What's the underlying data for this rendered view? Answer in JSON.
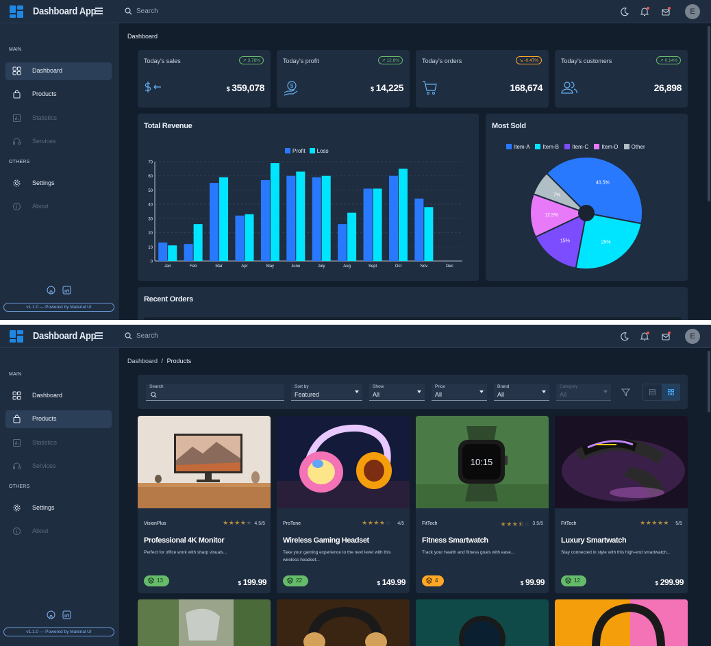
{
  "app": {
    "title": "Dashboard App",
    "avatar_letter": "E",
    "search_placeholder": "Search"
  },
  "sidebar": {
    "main_title": "MAIN",
    "others_title": "OTHERS",
    "items": [
      {
        "label": "Dashboard",
        "icon": "grid-icon"
      },
      {
        "label": "Products",
        "icon": "shopping-bag-icon"
      },
      {
        "label": "Statistics",
        "icon": "bar-chart-icon"
      },
      {
        "label": "Services",
        "icon": "headset-icon"
      },
      {
        "label": "Settings",
        "icon": "gear-icon"
      },
      {
        "label": "About",
        "icon": "info-icon"
      }
    ],
    "version": "v1.1.0 — Powered by Material UI"
  },
  "dashboard": {
    "breadcrumb": "Dashboard",
    "stats": [
      {
        "title": "Today's sales",
        "badge": "3.78%",
        "trend": "up",
        "currency": "$",
        "value": "359,078",
        "icon": "dollar-arrow-icon"
      },
      {
        "title": "Today's profit",
        "badge": "12.6%",
        "trend": "up",
        "currency": "$",
        "value": "14,225",
        "icon": "hand-coin-icon"
      },
      {
        "title": "Today's orders",
        "badge": "-0.47%",
        "trend": "down",
        "currency": "",
        "value": "168,674",
        "icon": "cart-icon"
      },
      {
        "title": "Today's customers",
        "badge": "0.14%",
        "trend": "up",
        "currency": "",
        "value": "26,898",
        "icon": "users-icon"
      }
    ],
    "revenue_title": "Total Revenue",
    "most_sold_title": "Most Sold",
    "recent_orders_title": "Recent Orders"
  },
  "chart_data": [
    {
      "type": "bar",
      "title": "Total Revenue",
      "categories": [
        "Jan",
        "Feb",
        "Mar",
        "Apr",
        "May",
        "June",
        "July",
        "Aug",
        "Sept",
        "Oct",
        "Nov",
        "Dec"
      ],
      "series": [
        {
          "name": "Profit",
          "color": "#2979ff",
          "values": [
            13,
            12,
            55,
            32,
            57,
            60,
            59,
            26,
            51,
            60,
            44,
            0
          ]
        },
        {
          "name": "Loss",
          "color": "#00e5ff",
          "values": [
            11,
            26,
            59,
            33,
            69,
            63,
            60,
            34,
            51,
            65,
            38,
            0
          ]
        }
      ],
      "ylim": [
        0,
        70
      ],
      "yticks": [
        0,
        10,
        20,
        30,
        40,
        50,
        60,
        70
      ],
      "grid": true,
      "legend": "top-center"
    },
    {
      "type": "pie",
      "title": "Most Sold",
      "categories": [
        "Item-A",
        "Item-B",
        "Item-C",
        "Item-D",
        "Other"
      ],
      "values": [
        40.5,
        25,
        15,
        12.5,
        7
      ],
      "labels": [
        "40.5%",
        "25%",
        "15%",
        "12.5%",
        "7%"
      ],
      "colors": [
        "#2979ff",
        "#00e5ff",
        "#7c4dff",
        "#e879f9",
        "#b0bec5"
      ],
      "legend": "top-center"
    }
  ],
  "products_page": {
    "breadcrumb_root": "Dashboard",
    "breadcrumb_sep": "/",
    "breadcrumb_current": "Products",
    "filters": {
      "search_label": "Search",
      "sort_label": "Sort by",
      "sort_value": "Featured",
      "show_label": "Show",
      "show_value": "All",
      "price_label": "Price",
      "price_value": "All",
      "brand_label": "Brand",
      "brand_value": "All",
      "category_label": "Category",
      "category_value": "All"
    },
    "products": [
      {
        "brand": "VisionPlus",
        "rating": "4.5/5",
        "rating_value": 4.5,
        "name": "Professional 4K Monitor",
        "desc": "Perfect for office work with sharp visuals...",
        "stock": "13",
        "stock_color": "#66bb6a",
        "currency": "$",
        "price": "199.99"
      },
      {
        "brand": "ProTone",
        "rating": "4/5",
        "rating_value": 4,
        "name": "Wireless Gaming Headset",
        "desc": "Take your gaming experience to the next level with this wireless headset...",
        "stock": "22",
        "stock_color": "#66bb6a",
        "currency": "$",
        "price": "149.99"
      },
      {
        "brand": "FitTech",
        "rating": "3.5/5",
        "rating_value": 3.5,
        "name": "Fitness Smartwatch",
        "desc": "Track your health and fitness goals with ease...",
        "stock": "4",
        "stock_color": "#ffa726",
        "currency": "$",
        "price": "99.99"
      },
      {
        "brand": "FitTech",
        "rating": "5/5",
        "rating_value": 5,
        "name": "Luxury Smartwatch",
        "desc": "Stay connected in style with this high-end smartwatch...",
        "stock": "12",
        "stock_color": "#66bb6a",
        "currency": "$",
        "price": "299.99"
      }
    ],
    "watch_time": "10:15"
  }
}
